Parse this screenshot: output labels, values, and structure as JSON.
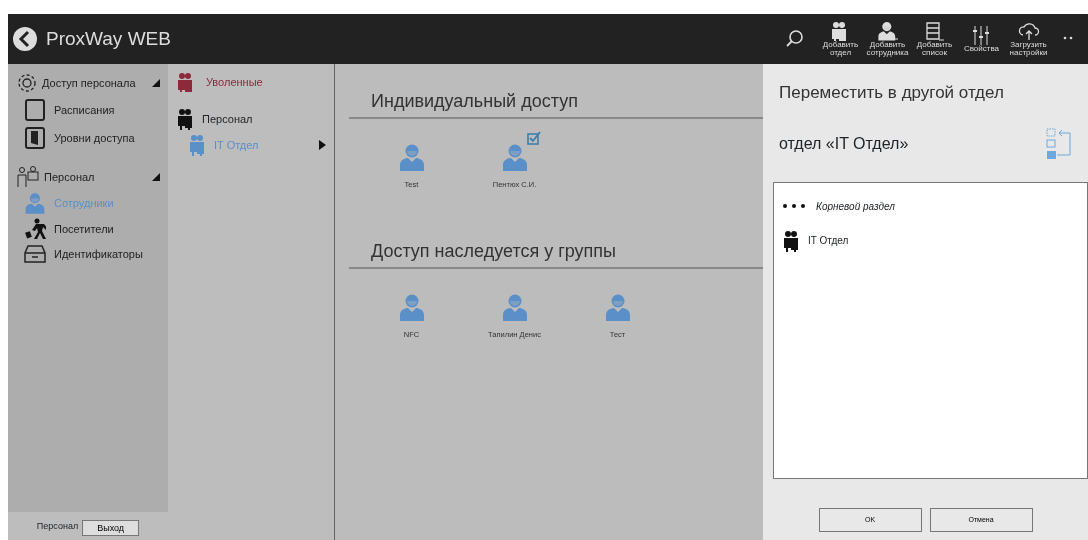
{
  "header": {
    "title": "ProxWay WEB",
    "toolbar": [
      {
        "kind": "search"
      },
      {
        "kind": "add-dept",
        "label": "Добавить отдел"
      },
      {
        "kind": "add-person",
        "label": "Добавить сотрудника"
      },
      {
        "kind": "add-list",
        "label": "Добавить список"
      },
      {
        "kind": "properties",
        "label": "Свойства"
      },
      {
        "kind": "upload",
        "label": "Загрузить настройки"
      },
      {
        "kind": "more"
      }
    ]
  },
  "sidebar": {
    "groups": [
      {
        "label": "Доступ персонала",
        "expanded": true,
        "items": [
          {
            "label": "Расписания",
            "selected": false
          },
          {
            "label": "Уровни доступа",
            "selected": false
          }
        ]
      },
      {
        "label": "Персонал",
        "expanded": true,
        "items": [
          {
            "label": "Сотрудники",
            "selected": true
          },
          {
            "label": "Посетители",
            "selected": false
          },
          {
            "label": "Идентификаторы",
            "selected": false
          }
        ]
      }
    ],
    "footer": {
      "user": "Персонал",
      "logout": "Выход"
    }
  },
  "departments": {
    "fired": "Уволенные",
    "tree": [
      {
        "label": "Персонал",
        "selected": false,
        "children": [
          {
            "label": "IT Отдел",
            "selected": true
          }
        ]
      }
    ]
  },
  "main": {
    "sections": [
      {
        "title": "Индивидуальный доступ",
        "people": [
          {
            "name": "Test",
            "checked": false
          },
          {
            "name": "Пентюх С.И.",
            "checked": true
          }
        ]
      },
      {
        "title": "Доступ наследуется у группы",
        "people": [
          {
            "name": "NFC",
            "checked": false
          },
          {
            "name": "Тапилин Денис",
            "checked": false
          },
          {
            "name": "Тест",
            "checked": false
          }
        ]
      }
    ]
  },
  "dialog": {
    "title": "Переместить в другой отдел",
    "subtitle": "отдел «IT Отдел»",
    "list": [
      {
        "kind": "root",
        "label": "Корневой раздел"
      },
      {
        "kind": "dept",
        "label": "IT Отдел"
      }
    ],
    "buttons": [
      "OK",
      "Отмена"
    ]
  }
}
